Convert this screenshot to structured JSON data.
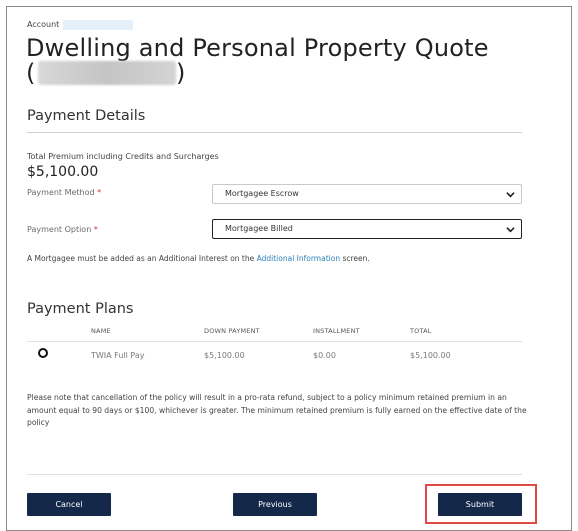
{
  "header": {
    "account_label": "Account",
    "title": "Dwelling and Personal Property Quote",
    "paren_open": "(",
    "paren_close": ")"
  },
  "payment_details": {
    "heading": "Payment Details",
    "premium_label": "Total Premium including Credits and Surcharges",
    "premium_value": "$5,100.00",
    "method_label": "Payment Method",
    "method_value": "Mortgagee Escrow",
    "option_label": "Payment Option",
    "option_value": "Mortgagee Billed",
    "required_mark": "*",
    "note_prefix": "A Mortgagee must be added as an Additional Interest on the",
    "note_link": "Additional Information",
    "note_suffix": "screen."
  },
  "payment_plans": {
    "heading": "Payment Plans",
    "columns": [
      "NAME",
      "DOWN PAYMENT",
      "INSTALLMENT",
      "TOTAL"
    ],
    "rows": [
      {
        "name": "TWIA Full Pay",
        "down_payment": "$5,100.00",
        "installment": "$0.00",
        "total": "$5,100.00"
      }
    ]
  },
  "disclaimer": "Please note that cancellation of the policy will result in a pro-rata refund, subject to a policy minimum retained premium in an amount equal to 90 days or $100, whichever is greater. The minimum retained premium is fully earned on the effective date of the policy",
  "buttons": {
    "cancel": "Cancel",
    "previous": "Previous",
    "submit": "Submit"
  },
  "colors": {
    "button_bg": "#14284a",
    "required": "#d0343a",
    "link": "#2d7fb8",
    "highlight": "#e04848"
  }
}
